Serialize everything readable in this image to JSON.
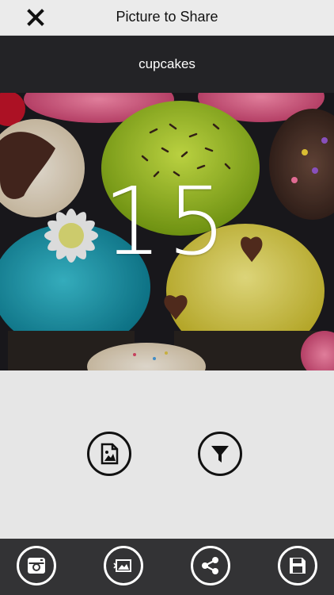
{
  "header": {
    "title": "Picture to Share",
    "close_icon": "close-icon"
  },
  "caption": {
    "text": "cupcakes"
  },
  "photo": {
    "subject": "cupcakes",
    "overlay_number": "15"
  },
  "actions": [
    {
      "icon": "image-file-icon"
    },
    {
      "icon": "filter-icon"
    }
  ],
  "toolbar": [
    {
      "icon": "camera-icon"
    },
    {
      "icon": "gallery-icon"
    },
    {
      "icon": "share-icon"
    },
    {
      "icon": "save-icon"
    }
  ],
  "colors": {
    "header_bg": "#ebebeb",
    "caption_bg": "#232326",
    "toolbar_bg": "#333335",
    "body_bg": "#e6e6e6"
  }
}
